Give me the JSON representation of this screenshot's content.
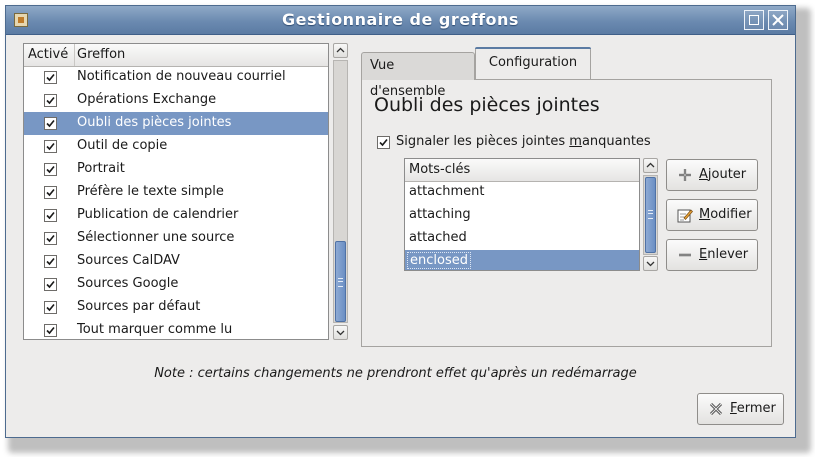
{
  "window": {
    "title": "Gestionnaire de greffons"
  },
  "plugin_list": {
    "headers": {
      "active": "Activé",
      "name": "Greffon"
    },
    "items": [
      {
        "label": "Notification de nouveau courriel",
        "checked": true,
        "selected": false
      },
      {
        "label": "Opérations Exchange",
        "checked": true,
        "selected": false
      },
      {
        "label": "Oubli des pièces jointes",
        "checked": true,
        "selected": true
      },
      {
        "label": "Outil de copie",
        "checked": true,
        "selected": false
      },
      {
        "label": "Portrait",
        "checked": true,
        "selected": false
      },
      {
        "label": "Préfère le texte simple",
        "checked": true,
        "selected": false
      },
      {
        "label": "Publication de calendrier",
        "checked": true,
        "selected": false
      },
      {
        "label": "Sélectionner une source",
        "checked": true,
        "selected": false
      },
      {
        "label": "Sources CalDAV",
        "checked": true,
        "selected": false
      },
      {
        "label": "Sources Google",
        "checked": true,
        "selected": false
      },
      {
        "label": "Sources par défaut",
        "checked": true,
        "selected": false
      },
      {
        "label": "Tout marquer comme lu",
        "checked": true,
        "selected": false
      }
    ]
  },
  "tabs": {
    "overview": "Vue d'ensemble",
    "configuration": "Configuration",
    "active": "configuration"
  },
  "config": {
    "plugin_title": "Oubli des pièces jointes",
    "remind_checkbox": {
      "label_before": "Signaler les pièces jointes ",
      "label_mnemonic": "m",
      "label_after": "anquantes",
      "checked": true
    },
    "keywords": {
      "header": "Mots-clés",
      "items": [
        {
          "label": "attachment",
          "selected": false
        },
        {
          "label": "attaching",
          "selected": false
        },
        {
          "label": "attached",
          "selected": false
        },
        {
          "label": "enclosed",
          "selected": true
        }
      ]
    },
    "buttons": {
      "add": {
        "mnemonic": "A",
        "rest": "jouter"
      },
      "edit": {
        "mnemonic": "M",
        "rest": "odifier"
      },
      "remove": {
        "mnemonic": "E",
        "rest": "nlever"
      }
    }
  },
  "footer": {
    "note": "Note : certains changements ne prendront effet qu'après un redémarrage",
    "close_button": {
      "mnemonic": "F",
      "rest": "ermer"
    }
  },
  "colors": {
    "titlebar": "#6b8ab0",
    "selection": "#7897c4",
    "window_bg": "#edeceb"
  }
}
